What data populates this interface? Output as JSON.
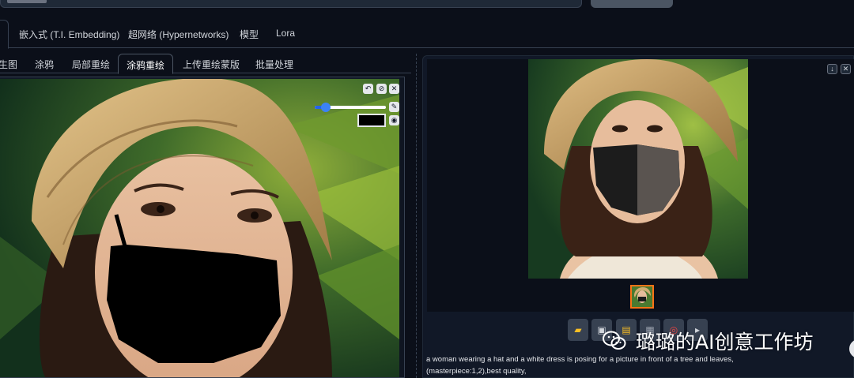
{
  "main_tabs": [
    {
      "label": "嵌入式 (T.I. Embedding)"
    },
    {
      "label": "超网络 (Hypernetworks)"
    },
    {
      "label": "模型"
    },
    {
      "label": "Lora"
    }
  ],
  "img2img_tabs": [
    {
      "label": "生图"
    },
    {
      "label": "涂鸦"
    },
    {
      "label": "局部重绘"
    },
    {
      "label": "涂鸦重绘",
      "active": true
    },
    {
      "label": "上传重绘蒙版"
    },
    {
      "label": "批量处理"
    }
  ],
  "editor": {
    "brush_size_fraction": 0.15,
    "brush_color": "#000000"
  },
  "output": {
    "prompt_line1": "a woman wearing a hat and a white dress is posing for a picture in front of a tree and leaves,",
    "prompt_line2": "(masterpiece:1,2),best quality,"
  },
  "watermark": {
    "text": "璐璐的AI创意工作坊"
  },
  "colors": {
    "background": "#0b0f19",
    "panel": "#111827",
    "accent_blue": "#3b82f6",
    "thumb_border": "#f97316"
  }
}
